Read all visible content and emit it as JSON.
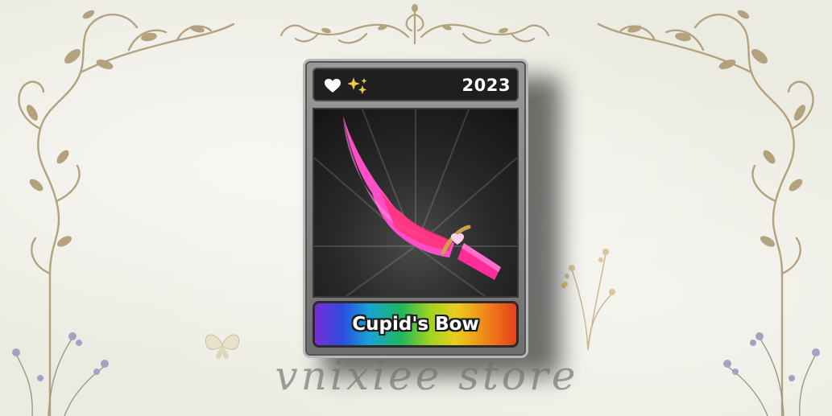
{
  "card": {
    "year": "2023",
    "item_name": "Cupid's Bow",
    "badges": [
      "heart-icon",
      "sparkle-icon"
    ]
  },
  "watermark": {
    "text": "vnixiee store"
  },
  "colors": {
    "background": "#ecebe2",
    "ornament": "#b3a27d",
    "blade_pink": "#ff4fc8",
    "blade_red": "#ff2d6e",
    "card_dark": "#1f1f1f"
  }
}
